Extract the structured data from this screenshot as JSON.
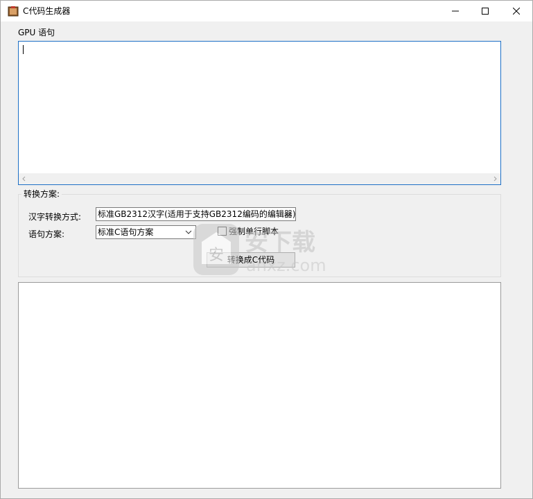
{
  "window": {
    "title": "C代码生成器",
    "controls": {
      "minimize": "minimize",
      "maximize": "maximize",
      "close": "close"
    }
  },
  "gpu_section": {
    "label": "GPU 语句",
    "text": ""
  },
  "scheme_group": {
    "title": "转换方案:",
    "hanzi_label": "汉字转换方式:",
    "hanzi_selected": "标准GB2312汉字(适用于支持GB2312编码的编辑器)",
    "sentence_label": "语句方案:",
    "sentence_selected": "标准C语句方案",
    "force_single_line_label": "强制单行脚本",
    "force_single_line_checked": false,
    "convert_button": "转换成C代码"
  },
  "output": {
    "text": ""
  },
  "watermark": {
    "brand": "安下载",
    "domain": "anxz.com"
  },
  "colors": {
    "focus_border": "#1c6fc6",
    "window_bg": "#f0f0f0"
  }
}
